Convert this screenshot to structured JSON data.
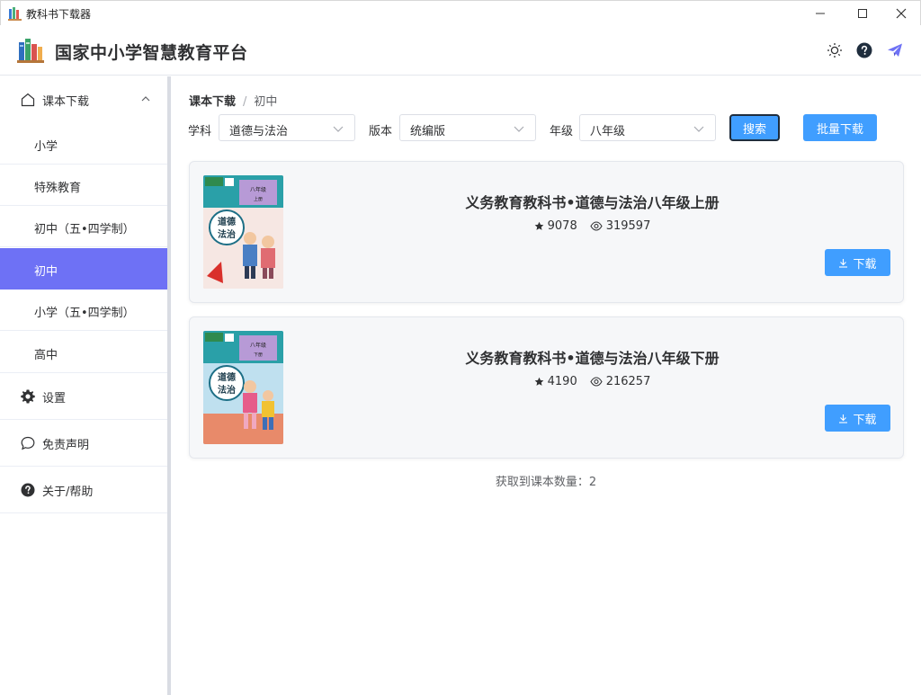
{
  "window": {
    "title": "教科书下载器"
  },
  "header": {
    "site_title": "国家中小学智慧教育平台"
  },
  "sidebar": {
    "group": {
      "label": "课本下载"
    },
    "sub_items": [
      {
        "label": "小学"
      },
      {
        "label": "特殊教育"
      },
      {
        "label": "初中（五•四学制）"
      },
      {
        "label": "初中",
        "active": true
      },
      {
        "label": "小学（五•四学制）"
      },
      {
        "label": "高中"
      }
    ],
    "items": [
      {
        "label": "设置",
        "icon": "gear-icon"
      },
      {
        "label": "免责声明",
        "icon": "chat-icon"
      },
      {
        "label": "关于/帮助",
        "icon": "help-icon"
      }
    ]
  },
  "breadcrumb": {
    "first": "课本下载",
    "sep": "/",
    "current": "初中"
  },
  "filters": {
    "subject": {
      "label": "学科",
      "value": "道德与法治"
    },
    "edition": {
      "label": "版本",
      "value": "统编版"
    },
    "grade": {
      "label": "年级",
      "value": "八年级"
    }
  },
  "buttons": {
    "search": "搜索",
    "batch": "批量下载",
    "download": "下载"
  },
  "books": [
    {
      "title": "义务教育教科书•道德与法治八年级上册",
      "stars": "9078",
      "views": "319597",
      "cover": {
        "grade": "八年级",
        "volume": "上册",
        "subject_top": "道德",
        "subject_bottom": "法治"
      }
    },
    {
      "title": "义务教育教科书•道德与法治八年级下册",
      "stars": "4190",
      "views": "216257",
      "cover": {
        "grade": "八年级",
        "volume": "下册",
        "subject_top": "道德",
        "subject_bottom": "法治"
      }
    }
  ],
  "footer": {
    "count_text": "获取到课本数量：2"
  },
  "colors": {
    "accent": "#6e71f5",
    "primary": "#409eff"
  }
}
